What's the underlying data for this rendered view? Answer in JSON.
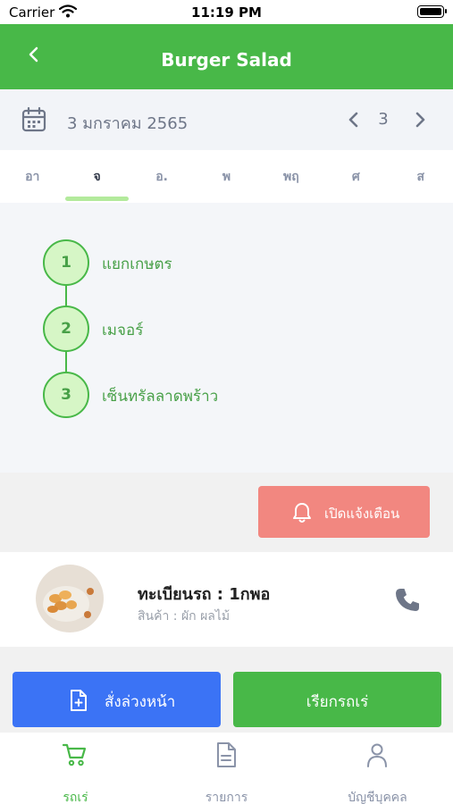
{
  "status_bar": {
    "carrier": "Carrier",
    "time": "11:19 PM"
  },
  "header": {
    "title": "Burger Salad"
  },
  "date_bar": {
    "date": "3 มกราคม 2565",
    "page": "3"
  },
  "day_tabs": [
    {
      "label": "อา",
      "active": false
    },
    {
      "label": "จ",
      "active": true
    },
    {
      "label": "อ.",
      "active": false
    },
    {
      "label": "พ",
      "active": false
    },
    {
      "label": "พฤ",
      "active": false
    },
    {
      "label": "ศ",
      "active": false
    },
    {
      "label": "ส",
      "active": false
    }
  ],
  "route_stops": [
    {
      "number": "1",
      "label": "แยกเกษตร"
    },
    {
      "number": "2",
      "label": "เมจอร์"
    },
    {
      "number": "3",
      "label": "เซ็นทรัลลาดพร้าว"
    }
  ],
  "alert": {
    "label": "เปิดแจ้งเตือน",
    "icon": "bell-icon"
  },
  "vehicle": {
    "plate": "ทะเบียนรถ : 1กพอ",
    "goods": "สินค้า : ผัก ผลไม้",
    "icon": "phone-icon"
  },
  "actions": {
    "pre_order": "สั่งล่วงหน้า",
    "call_car": "เรียกรถเร่"
  },
  "bottom_nav": [
    {
      "label": "รถเร่",
      "icon": "cart-icon",
      "active": true
    },
    {
      "label": "รายการ",
      "icon": "document-icon",
      "active": false
    },
    {
      "label": "บัญชีบุคคล",
      "icon": "person-icon",
      "active": false
    }
  ],
  "colors": {
    "brand_green": "#48b848",
    "alert_red": "#f28780",
    "primary_blue": "#3b73f5",
    "muted_text": "#8a93a8"
  }
}
